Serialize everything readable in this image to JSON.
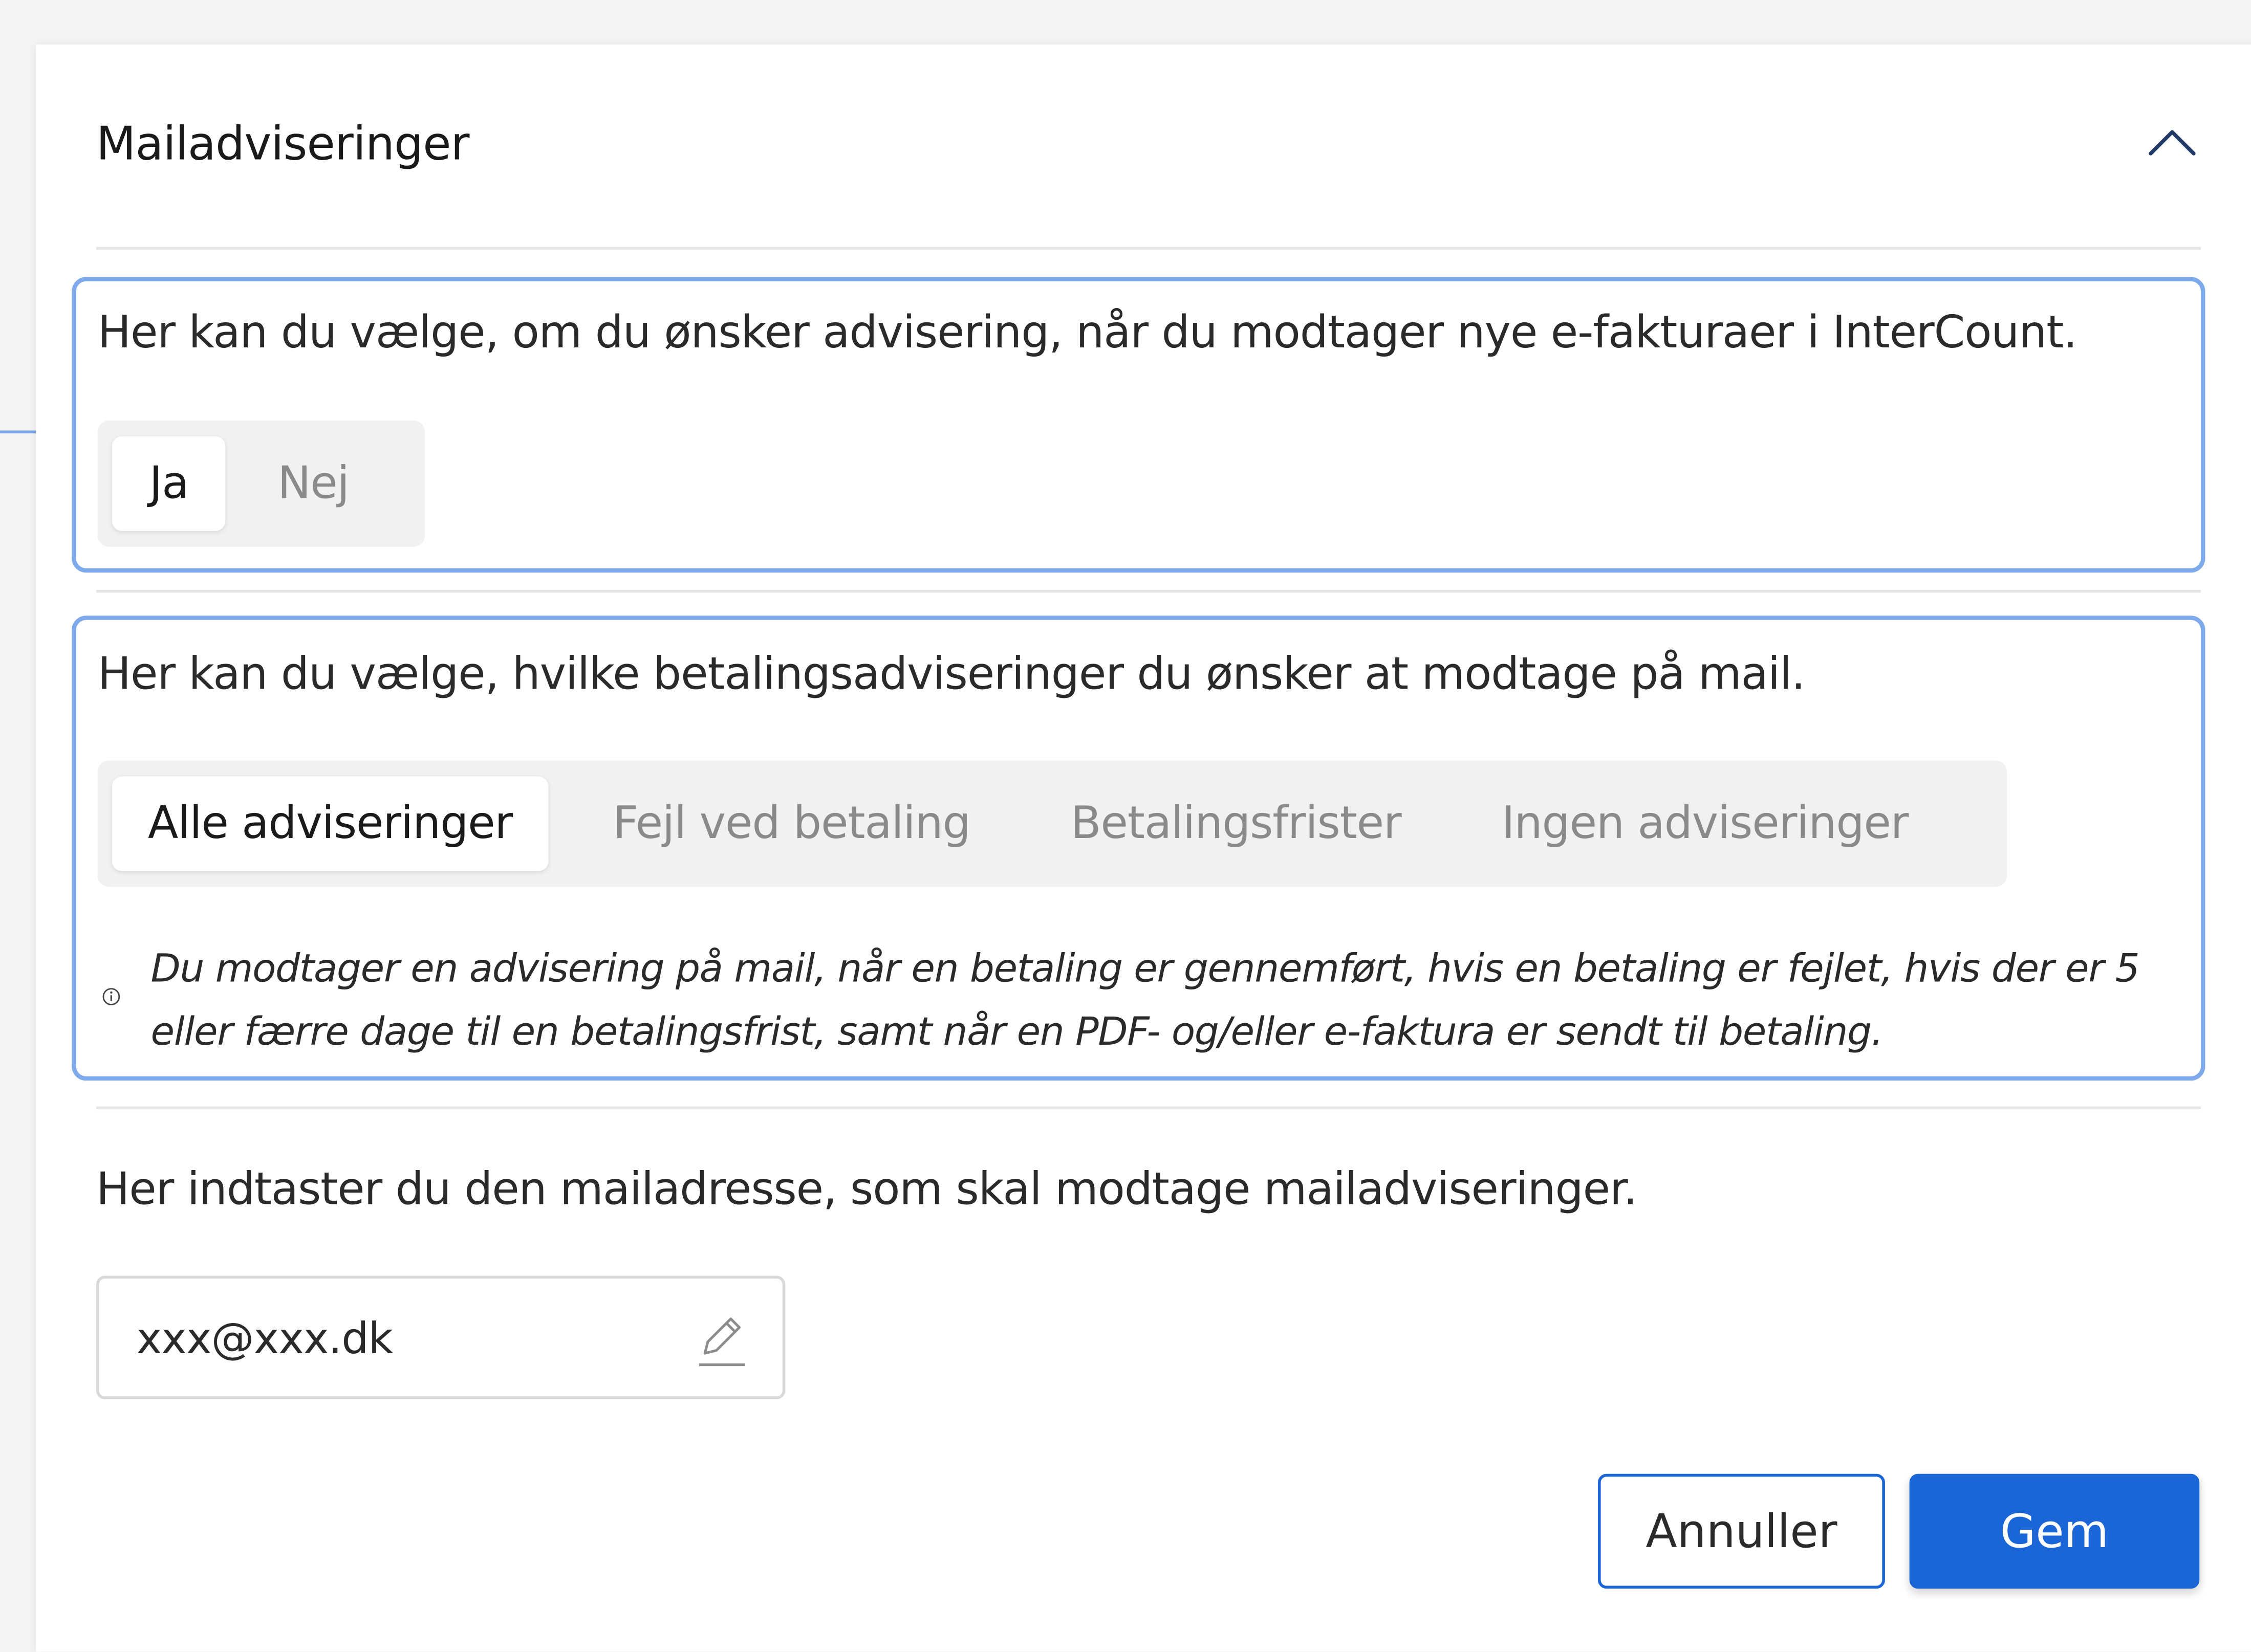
{
  "header": {
    "title": "Mailadviseringer"
  },
  "invoice_notifications": {
    "description": "Her kan du vælge, om du ønsker advisering, når du modtager nye e-fakturaer i InterCount.",
    "options": [
      "Ja",
      "Nej"
    ],
    "selected": "Ja"
  },
  "payment_notifications": {
    "description": "Her kan du vælge, hvilke betalingsadviseringer du ønsker at modtage på mail.",
    "options": [
      "Alle adviseringer",
      "Fejl ved betaling",
      "Betalingsfrister",
      "Ingen adviseringer"
    ],
    "selected": "Alle adviseringer",
    "note": "Du modtager en advisering på mail, når en betaling er gennemført, hvis en betaling er fejlet, hvis der er 5 eller færre dage til en betalingsfrist, samt når en PDF- og/eller e-faktura er sendt til betaling."
  },
  "email": {
    "description": "Her indtaster du den mailadresse, som skal modtage mailadviseringer.",
    "value": "xxx@xxx.dk"
  },
  "actions": {
    "cancel_label": "Annuller",
    "save_label": "Gem"
  },
  "colors": {
    "accent": "#1a66d6",
    "highlight_border": "#7ea9ea"
  },
  "icons": {
    "collapse": "chevron-up-icon",
    "info": "info-icon",
    "edit": "pencil-icon"
  }
}
